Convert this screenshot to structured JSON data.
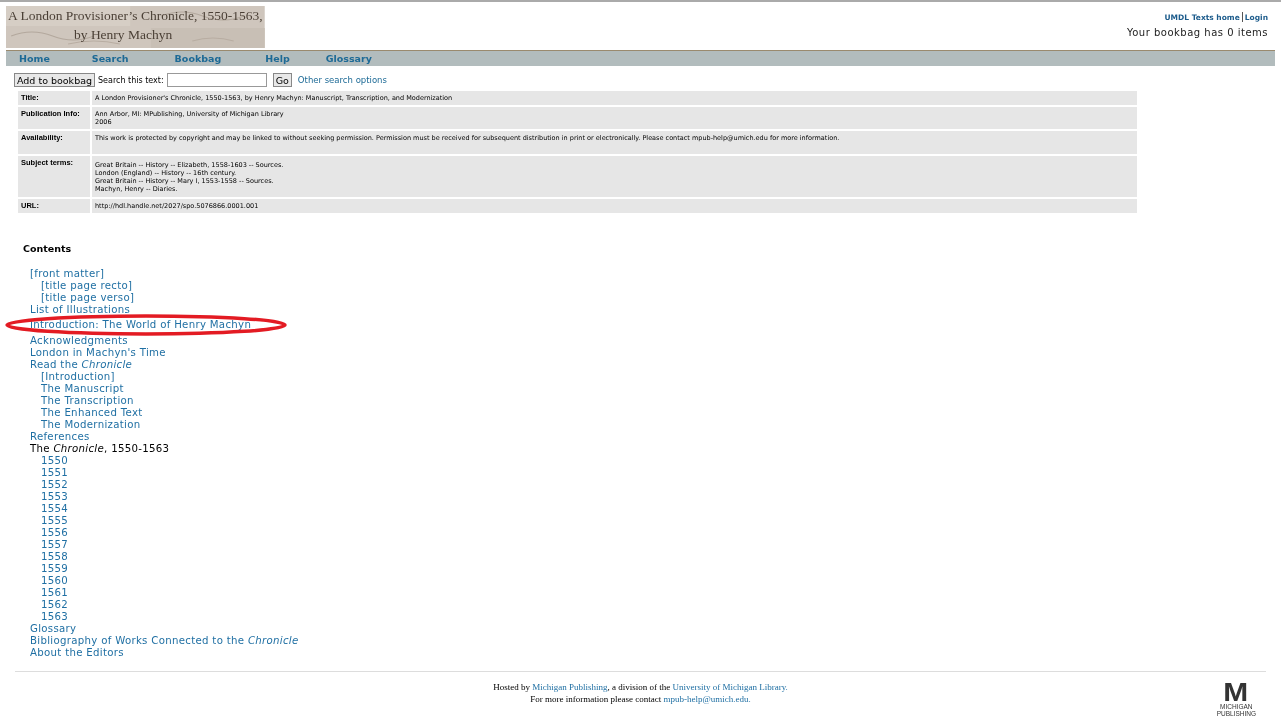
{
  "banner": {
    "title_lines": [
      "A London Provisioner’s Chronicle, 1550-1563,",
      "by Henry Machyn"
    ]
  },
  "top_links": [
    "UMDL Texts home",
    "Login"
  ],
  "bookbag_status": "Your bookbag has 0 items",
  "nav": [
    "Home",
    "Search",
    "Bookbag",
    "Help",
    "Glossary"
  ],
  "toolbar": {
    "add_button": "Add to bookbag",
    "search_label": "Search this text:",
    "go_button": "Go",
    "options_link": "Other search options"
  },
  "metadata": [
    {
      "label": "Title:",
      "lines": [
        "A London Provisioner's Chronicle, 1550-1563, by Henry Machyn: Manuscript, Transcription, and Modernization"
      ]
    },
    {
      "label": "Publication Info:",
      "lines": [
        "Ann Arbor, MI: MPublishing, University of Michigan Library",
        "2006"
      ]
    },
    {
      "label": "Availability:",
      "lines": [
        "This work is protected by copyright and may be linked to without seeking permission. Permission must be received for subsequent distribution in print or electronically. Please contact mpub-help@umich.edu for more information."
      ]
    },
    {
      "label": "Subject terms:",
      "lines": [
        "Great Britain -- History -- Elizabeth, 1558-1603 -- Sources.",
        "London (England) -- History -- 16th century.",
        "Great Britain -- History -- Mary I, 1553-1558 -- Sources.",
        "Machyn, Henry -- Diaries."
      ]
    },
    {
      "label": "URL:",
      "lines": [
        "http://hdl.handle.net/2027/spo.5076866.0001.001"
      ]
    }
  ],
  "contents": {
    "heading": "Contents",
    "items": [
      {
        "text": "[front matter]",
        "link": true,
        "children": [
          {
            "text": "[title page recto]",
            "link": true
          },
          {
            "text": "[title page verso]",
            "link": true
          }
        ]
      },
      {
        "text": "List of Illustrations",
        "link": true
      },
      {
        "text": "Introduction: The World of Henry Machyn",
        "link": true,
        "circled": true
      },
      {
        "text": "Acknowledgments",
        "link": true
      },
      {
        "text": "London in Machyn's Time",
        "link": true
      },
      {
        "text": "Read the *Chronicle*",
        "link": true,
        "children": [
          {
            "text": "[Introduction]",
            "link": true
          },
          {
            "text": "The Manuscript",
            "link": true
          },
          {
            "text": "The Transcription",
            "link": true
          },
          {
            "text": "The Enhanced Text",
            "link": true
          },
          {
            "text": "The Modernization",
            "link": true
          }
        ]
      },
      {
        "text": "References",
        "link": true
      },
      {
        "text": "The *Chronicle*, 1550-1563",
        "link": false,
        "children": [
          {
            "text": "1550",
            "link": true
          },
          {
            "text": "1551",
            "link": true
          },
          {
            "text": "1552",
            "link": true
          },
          {
            "text": "1553",
            "link": true
          },
          {
            "text": "1554",
            "link": true
          },
          {
            "text": "1555",
            "link": true
          },
          {
            "text": "1556",
            "link": true
          },
          {
            "text": "1557",
            "link": true
          },
          {
            "text": "1558",
            "link": true
          },
          {
            "text": "1559",
            "link": true
          },
          {
            "text": "1560",
            "link": true
          },
          {
            "text": "1561",
            "link": true
          },
          {
            "text": "1562",
            "link": true
          },
          {
            "text": "1563",
            "link": true
          }
        ]
      },
      {
        "text": "Glossary",
        "link": true
      },
      {
        "text": "Bibliography of Works Connected to the *Chronicle*",
        "link": true
      },
      {
        "text": "About the Editors",
        "link": true
      }
    ]
  },
  "footer": {
    "line1": [
      {
        "text": "Hosted by ",
        "link": false
      },
      {
        "text": "Michigan Publishing",
        "link": true
      },
      {
        "text": ", a division of the ",
        "link": false
      },
      {
        "text": "University of Michigan Library.",
        "link": true
      }
    ],
    "line2": [
      {
        "text": "For more information please contact ",
        "link": false
      },
      {
        "text": "mpub-help@umich.edu.",
        "link": true
      }
    ],
    "logo": {
      "mark": "M",
      "lines": [
        "MICHIGAN",
        "PUBLISHING"
      ]
    }
  }
}
